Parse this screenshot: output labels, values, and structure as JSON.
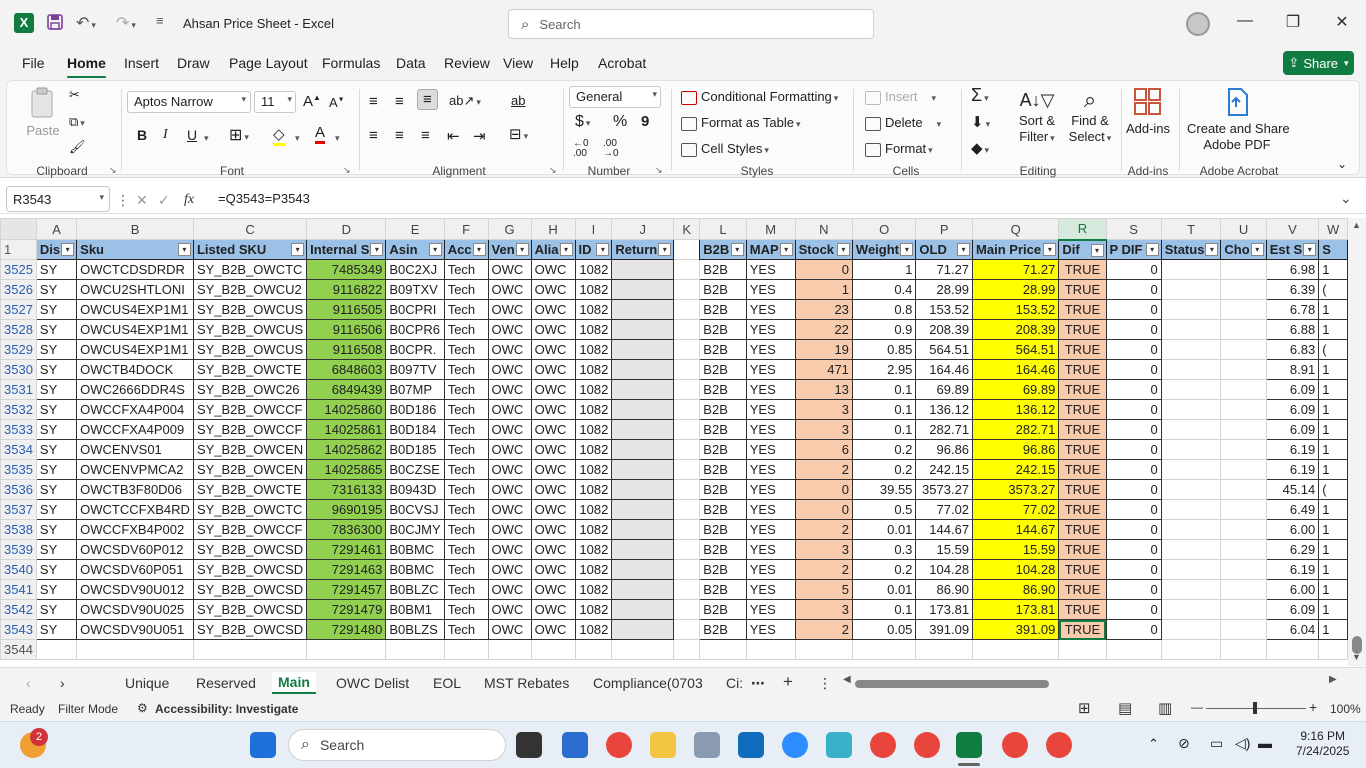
{
  "window": {
    "app_icon": "X",
    "title": "Ahsan Price Sheet  -  Excel",
    "search_placeholder": "Search"
  },
  "menu": [
    "File",
    "Home",
    "Insert",
    "Draw",
    "Page Layout",
    "Formulas",
    "Data",
    "Review",
    "View",
    "Help",
    "Acrobat"
  ],
  "share_label": "Share",
  "ribbon": {
    "clipboard": {
      "paste": "Paste",
      "label": "Clipboard"
    },
    "font": {
      "name": "Aptos Narrow",
      "size": "11",
      "label": "Font",
      "bold": "B",
      "italic": "I",
      "underline": "U"
    },
    "alignment": {
      "label": "Alignment"
    },
    "number": {
      "format": "General",
      "label": "Number",
      "currency": "$",
      "percent": "%",
      "comma": "9"
    },
    "styles": {
      "conditional": "Conditional Formatting",
      "table": "Format as Table",
      "cell": "Cell Styles",
      "label": "Styles"
    },
    "cells": {
      "insert": "Insert",
      "delete": "Delete",
      "format": "Format",
      "label": "Cells"
    },
    "editing": {
      "sort_l1": "Sort &",
      "sort_l2": "Filter",
      "find_l1": "Find &",
      "find_l2": "Select",
      "label": "Editing",
      "sum": "Σ"
    },
    "addins": {
      "btn": "Add-ins",
      "label": "Add-ins"
    },
    "acrobat": {
      "l1": "Create and Share",
      "l2": "Adobe PDF",
      "label": "Adobe Acrobat"
    }
  },
  "formula_bar": {
    "name_box": "R3543",
    "formula": "=Q3543=P3543"
  },
  "columns": [
    "A",
    "B",
    "C",
    "D",
    "E",
    "F",
    "G",
    "H",
    "I",
    "J",
    "K",
    "L",
    "M",
    "N",
    "O",
    "P",
    "Q",
    "R",
    "S",
    "T",
    "U",
    "V",
    "W"
  ],
  "header_row": {
    "num": "1",
    "cells": [
      "Dis",
      "Sku",
      "Listed SKU",
      "Internal S",
      "Asin",
      "Acc",
      "Ven",
      "Alia",
      "ID",
      "Return",
      "",
      "B2B",
      "MAP",
      "Stock",
      "Weight",
      "OLD",
      "Main Price",
      "Dif",
      "P DIF",
      "Status",
      "Cho",
      "Est S",
      "S"
    ]
  },
  "rows": [
    {
      "n": "3525",
      "a": "SY",
      "b": "OWCTCDSDRDR",
      "c": "SY_B2B_OWCTC",
      "d": "7485349",
      "e": "B0C2XJ",
      "f": "Tech",
      "g": "OWC",
      "h": "OWC",
      "i": "1082",
      "l": "B2B",
      "m": "YES",
      "stock": "0",
      "weight": "1",
      "old": "71.27",
      "main": "71.27",
      "dif": "TRUE",
      "pdif": "0",
      "est": "6.98",
      "w": "1"
    },
    {
      "n": "3526",
      "a": "SY",
      "b": "OWCU2SHTLONI",
      "c": "SY_B2B_OWCU2",
      "d": "9116822",
      "e": "B09TXV",
      "f": "Tech",
      "g": "OWC",
      "h": "OWC",
      "i": "1082",
      "l": "B2B",
      "m": "YES",
      "stock": "1",
      "weight": "0.4",
      "old": "28.99",
      "main": "28.99",
      "dif": "TRUE",
      "pdif": "0",
      "est": "6.39",
      "w": "("
    },
    {
      "n": "3527",
      "a": "SY",
      "b": "OWCUS4EXP1M1",
      "c": "SY_B2B_OWCUS",
      "d": "9116505",
      "e": "B0CPRI",
      "f": "Tech",
      "g": "OWC",
      "h": "OWC",
      "i": "1082",
      "l": "B2B",
      "m": "YES",
      "stock": "23",
      "weight": "0.8",
      "old": "153.52",
      "main": "153.52",
      "dif": "TRUE",
      "pdif": "0",
      "est": "6.78",
      "w": "1"
    },
    {
      "n": "3528",
      "a": "SY",
      "b": "OWCUS4EXP1M1",
      "c": "SY_B2B_OWCUS",
      "d": "9116506",
      "e": "B0CPR6",
      "f": "Tech",
      "g": "OWC",
      "h": "OWC",
      "i": "1082",
      "l": "B2B",
      "m": "YES",
      "stock": "22",
      "weight": "0.9",
      "old": "208.39",
      "main": "208.39",
      "dif": "TRUE",
      "pdif": "0",
      "est": "6.88",
      "w": "1"
    },
    {
      "n": "3529",
      "a": "SY",
      "b": "OWCUS4EXP1M1",
      "c": "SY_B2B_OWCUS",
      "d": "9116508",
      "e": "B0CPR.",
      "f": "Tech",
      "g": "OWC",
      "h": "OWC",
      "i": "1082",
      "l": "B2B",
      "m": "YES",
      "stock": "19",
      "weight": "0.85",
      "old": "564.51",
      "main": "564.51",
      "dif": "TRUE",
      "pdif": "0",
      "est": "6.83",
      "w": "("
    },
    {
      "n": "3530",
      "a": "SY",
      "b": "OWCTB4DOCK",
      "c": "SY_B2B_OWCTE",
      "d": "6848603",
      "e": "B097TV",
      "f": "Tech",
      "g": "OWC",
      "h": "OWC",
      "i": "1082",
      "l": "B2B",
      "m": "YES",
      "stock": "471",
      "weight": "2.95",
      "old": "164.46",
      "main": "164.46",
      "dif": "TRUE",
      "pdif": "0",
      "est": "8.91",
      "w": "1"
    },
    {
      "n": "3531",
      "a": "SY",
      "b": "OWC2666DDR4S",
      "c": "SY_B2B_OWC26",
      "d": "6849439",
      "e": "B07MP",
      "f": "Tech",
      "g": "OWC",
      "h": "OWC",
      "i": "1082",
      "l": "B2B",
      "m": "YES",
      "stock": "13",
      "weight": "0.1",
      "old": "69.89",
      "main": "69.89",
      "dif": "TRUE",
      "pdif": "0",
      "est": "6.09",
      "w": "1"
    },
    {
      "n": "3532",
      "a": "SY",
      "b": "OWCCFXA4P004",
      "c": "SY_B2B_OWCCF",
      "d": "14025860",
      "e": "B0D186",
      "f": "Tech",
      "g": "OWC",
      "h": "OWC",
      "i": "1082",
      "l": "B2B",
      "m": "YES",
      "stock": "3",
      "weight": "0.1",
      "old": "136.12",
      "main": "136.12",
      "dif": "TRUE",
      "pdif": "0",
      "est": "6.09",
      "w": "1"
    },
    {
      "n": "3533",
      "a": "SY",
      "b": "OWCCFXA4P009",
      "c": "SY_B2B_OWCCF",
      "d": "14025861",
      "e": "B0D184",
      "f": "Tech",
      "g": "OWC",
      "h": "OWC",
      "i": "1082",
      "l": "B2B",
      "m": "YES",
      "stock": "3",
      "weight": "0.1",
      "old": "282.71",
      "main": "282.71",
      "dif": "TRUE",
      "pdif": "0",
      "est": "6.09",
      "w": "1"
    },
    {
      "n": "3534",
      "a": "SY",
      "b": "OWCENVS01",
      "c": "SY_B2B_OWCEN",
      "d": "14025862",
      "e": "B0D185",
      "f": "Tech",
      "g": "OWC",
      "h": "OWC",
      "i": "1082",
      "l": "B2B",
      "m": "YES",
      "stock": "6",
      "weight": "0.2",
      "old": "96.86",
      "main": "96.86",
      "dif": "TRUE",
      "pdif": "0",
      "est": "6.19",
      "w": "1"
    },
    {
      "n": "3535",
      "a": "SY",
      "b": "OWCENVPMCA2",
      "c": "SY_B2B_OWCEN",
      "d": "14025865",
      "e": "B0CZSE",
      "f": "Tech",
      "g": "OWC",
      "h": "OWC",
      "i": "1082",
      "l": "B2B",
      "m": "YES",
      "stock": "2",
      "weight": "0.2",
      "old": "242.15",
      "main": "242.15",
      "dif": "TRUE",
      "pdif": "0",
      "est": "6.19",
      "w": "1"
    },
    {
      "n": "3536",
      "a": "SY",
      "b": "OWCTB3F80D06",
      "c": "SY_B2B_OWCTE",
      "d": "7316133",
      "e": "B0943D",
      "f": "Tech",
      "g": "OWC",
      "h": "OWC",
      "i": "1082",
      "l": "B2B",
      "m": "YES",
      "stock": "0",
      "weight": "39.55",
      "old": "3573.27",
      "main": "3573.27",
      "dif": "TRUE",
      "pdif": "0",
      "est": "45.14",
      "w": "("
    },
    {
      "n": "3537",
      "a": "SY",
      "b": "OWCTCCFXB4RD",
      "c": "SY_B2B_OWCTC",
      "d": "9690195",
      "e": "B0CVSJ",
      "f": "Tech",
      "g": "OWC",
      "h": "OWC",
      "i": "1082",
      "l": "B2B",
      "m": "YES",
      "stock": "0",
      "weight": "0.5",
      "old": "77.02",
      "main": "77.02",
      "dif": "TRUE",
      "pdif": "0",
      "est": "6.49",
      "w": "1"
    },
    {
      "n": "3538",
      "a": "SY",
      "b": "OWCCFXB4P002",
      "c": "SY_B2B_OWCCF",
      "d": "7836300",
      "e": "B0CJMY",
      "f": "Tech",
      "g": "OWC",
      "h": "OWC",
      "i": "1082",
      "l": "B2B",
      "m": "YES",
      "stock": "2",
      "weight": "0.01",
      "old": "144.67",
      "main": "144.67",
      "dif": "TRUE",
      "pdif": "0",
      "est": "6.00",
      "w": "1"
    },
    {
      "n": "3539",
      "a": "SY",
      "b": "OWCSDV60P012",
      "c": "SY_B2B_OWCSD",
      "d": "7291461",
      "e": "B0BMC",
      "f": "Tech",
      "g": "OWC",
      "h": "OWC",
      "i": "1082",
      "l": "B2B",
      "m": "YES",
      "stock": "3",
      "weight": "0.3",
      "old": "15.59",
      "main": "15.59",
      "dif": "TRUE",
      "pdif": "0",
      "est": "6.29",
      "w": "1"
    },
    {
      "n": "3540",
      "a": "SY",
      "b": "OWCSDV60P051",
      "c": "SY_B2B_OWCSD",
      "d": "7291463",
      "e": "B0BMC",
      "f": "Tech",
      "g": "OWC",
      "h": "OWC",
      "i": "1082",
      "l": "B2B",
      "m": "YES",
      "stock": "2",
      "weight": "0.2",
      "old": "104.28",
      "main": "104.28",
      "dif": "TRUE",
      "pdif": "0",
      "est": "6.19",
      "w": "1"
    },
    {
      "n": "3541",
      "a": "SY",
      "b": "OWCSDV90U012",
      "c": "SY_B2B_OWCSD",
      "d": "7291457",
      "e": "B0BLZC",
      "f": "Tech",
      "g": "OWC",
      "h": "OWC",
      "i": "1082",
      "l": "B2B",
      "m": "YES",
      "stock": "5",
      "weight": "0.01",
      "old": "86.90",
      "main": "86.90",
      "dif": "TRUE",
      "pdif": "0",
      "est": "6.00",
      "w": "1"
    },
    {
      "n": "3542",
      "a": "SY",
      "b": "OWCSDV90U025",
      "c": "SY_B2B_OWCSD",
      "d": "7291479",
      "e": "B0BM1",
      "f": "Tech",
      "g": "OWC",
      "h": "OWC",
      "i": "1082",
      "l": "B2B",
      "m": "YES",
      "stock": "3",
      "weight": "0.1",
      "old": "173.81",
      "main": "173.81",
      "dif": "TRUE",
      "pdif": "0",
      "est": "6.09",
      "w": "1"
    },
    {
      "n": "3543",
      "a": "SY",
      "b": "OWCSDV90U051",
      "c": "SY_B2B_OWCSD",
      "d": "7291480",
      "e": "B0BLZS",
      "f": "Tech",
      "g": "OWC",
      "h": "OWC",
      "i": "1082",
      "l": "B2B",
      "m": "YES",
      "stock": "2",
      "weight": "0.05",
      "old": "391.09",
      "main": "391.09",
      "dif": "TRUE",
      "pdif": "0",
      "est": "6.04",
      "w": "1"
    }
  ],
  "empty_row": "3544",
  "sheet_tabs": [
    "Unique",
    "Reserved",
    "Main",
    "OWC Delist",
    "EOL",
    "MST Rebates",
    "Compliance(0703",
    "Ci:"
  ],
  "active_tab": "Main",
  "status": {
    "ready": "Ready",
    "filter": "Filter Mode",
    "accessibility": "Accessibility: Investigate",
    "zoom": "100%"
  },
  "taskbar": {
    "search": "Search",
    "time": "9:16 PM",
    "date": "7/24/2025",
    "badge": "2"
  },
  "colors": {
    "excel_green": "#107c41",
    "green_fill": "#92d050",
    "salmon_fill": "#f8cbad",
    "yellow_fill": "#ffff00",
    "grey_fill": "#e7e6e6"
  }
}
